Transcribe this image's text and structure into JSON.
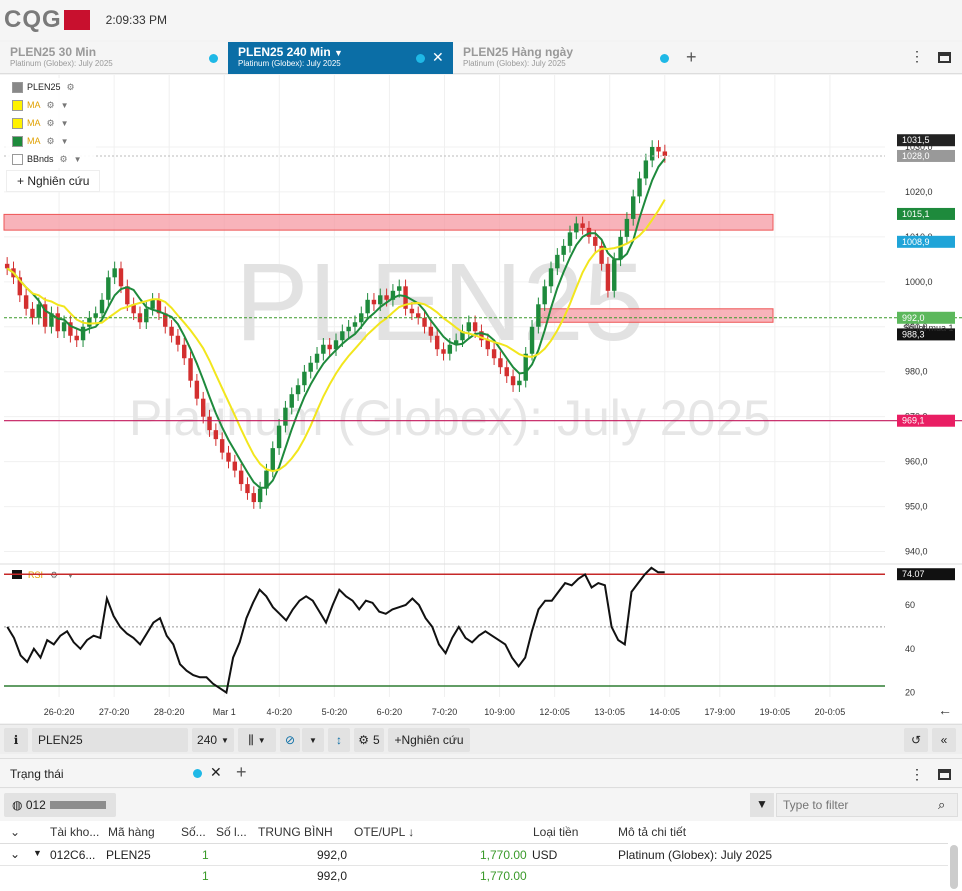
{
  "app": {
    "logo": "CQG",
    "clock": "2:09:33 PM"
  },
  "tabs": [
    {
      "title": "PLEN25 30 Min",
      "subtitle": "Platinum (Globex): July 2025"
    },
    {
      "title": "PLEN25 240 Min",
      "subtitle": "Platinum (Globex): July 2025"
    },
    {
      "title": "PLEN25 Hàng ngày",
      "subtitle": "Platinum (Globex): July 2025"
    }
  ],
  "legend": {
    "symbol": "PLEN25",
    "ma1": "MA",
    "ma2": "MA",
    "ma3": "MA",
    "bbands": "BBnds",
    "research": "Nghiên cứu"
  },
  "watermark": {
    "symbol": "PLEN25",
    "desc": "Platinum (Globex): July 2025"
  },
  "chart_data": [
    {
      "type": "candlestick",
      "title": "PLEN25 240 Min",
      "ylim": [
        937,
        1036
      ],
      "y_ticks": [
        "940,0",
        "950,0",
        "960,0",
        "970,0",
        "980,0",
        "990,0",
        "1000,0",
        "1010,0",
        "1020,0",
        "1030,0"
      ],
      "price_labels": [
        "1031,5",
        "1028,0",
        "1015,1",
        "1008,9",
        "992,0",
        "988,3",
        "969,1"
      ],
      "position_label": "Số lot mua 1",
      "x_labels": [
        "26-0:20",
        "27-0:20",
        "28-0:20",
        "Mar 1",
        "4-0:20",
        "5-0:20",
        "6-0:20",
        "7-0:20",
        "10-9:00",
        "12-0:05",
        "13-0:05",
        "14-0:05",
        "17-9:00",
        "19-0:05",
        "20-0:05"
      ],
      "closes": [
        1003,
        1001,
        997,
        994,
        992,
        995,
        990,
        993,
        989,
        991,
        988,
        987,
        990,
        992,
        993,
        996,
        1001,
        1003,
        999,
        995,
        993,
        991,
        994,
        996,
        993,
        990,
        988,
        986,
        983,
        978,
        974,
        970,
        967,
        965,
        962,
        960,
        958,
        955,
        953,
        951,
        954,
        958,
        963,
        968,
        972,
        975,
        977,
        980,
        982,
        984,
        986,
        985,
        987,
        989,
        990,
        991,
        993,
        996,
        995,
        997,
        996,
        998,
        999,
        994,
        993,
        992,
        990,
        988,
        985,
        984,
        986,
        987,
        989,
        991,
        989,
        987,
        985,
        983,
        981,
        979,
        977,
        978,
        984,
        990,
        995,
        999,
        1003,
        1006,
        1008,
        1011,
        1013,
        1012,
        1010,
        1008,
        1004,
        998,
        1005,
        1010,
        1014,
        1019,
        1023,
        1027,
        1030,
        1029,
        1028
      ],
      "series": [
        {
          "name": "MA",
          "color": "#1e8a3c"
        },
        {
          "name": "MA",
          "color": "#f2e61d"
        }
      ],
      "zones": [
        {
          "from": 1011.5,
          "to": 1015
        },
        {
          "from": 991,
          "to": 994
        }
      ]
    },
    {
      "type": "line",
      "title": "RSI",
      "ylim": [
        18,
        76
      ],
      "y_ticks": [
        "20",
        "40",
        "60"
      ],
      "last_value": "74.07",
      "levels": [
        74.07,
        50,
        23
      ],
      "values": [
        50,
        45,
        37,
        34,
        40,
        36,
        44,
        42,
        46,
        48,
        43,
        40,
        44,
        46,
        45,
        63,
        55,
        50,
        47,
        45,
        42,
        47,
        52,
        54,
        46,
        42,
        33,
        30,
        28,
        27,
        27,
        24,
        22,
        20,
        36,
        43,
        54,
        61,
        67,
        64,
        59,
        56,
        53,
        58,
        62,
        64,
        62,
        57,
        52,
        60,
        67,
        64,
        62,
        58,
        62,
        61,
        57,
        56,
        58,
        59,
        60,
        63,
        60,
        54,
        50,
        42,
        38,
        45,
        50,
        45,
        43,
        46,
        48,
        46,
        44,
        42,
        36,
        32,
        36,
        48,
        58,
        62,
        62,
        66,
        70,
        69,
        72,
        74,
        68,
        70,
        69,
        50,
        44,
        42,
        66,
        70,
        74,
        77,
        75,
        75
      ]
    }
  ],
  "toolbar": {
    "symbol": "PLEN25",
    "interval": "240",
    "studies_count": "5",
    "research": "Nghiên cứu"
  },
  "status": {
    "title": "Trạng thái",
    "account": "012",
    "filter_placeholder": "Type to filter",
    "columns": [
      "Tài kho...",
      "Mã hàng",
      "Số...",
      "Số l...",
      "TRUNG BÌNH",
      "OTE/UPL",
      "Loại tiền",
      "Mô tả chi tiết"
    ],
    "rows": [
      {
        "account": "012C6...",
        "symbol": "PLEN25",
        "qty": "1",
        "avg": "992,0",
        "ote": "1,770.00",
        "currency": "USD",
        "desc": "Platinum (Globex): July 2025"
      },
      {
        "account": "",
        "symbol": "",
        "qty": "1",
        "avg": "992,0",
        "ote": "1,770.00",
        "currency": "",
        "desc": ""
      }
    ]
  },
  "colors": {
    "accent": "#0b6ea6",
    "up": "#1e8a3c",
    "down": "#d32f2f",
    "zone": "#f59aa3",
    "ma_yellow": "#f2e61d"
  }
}
